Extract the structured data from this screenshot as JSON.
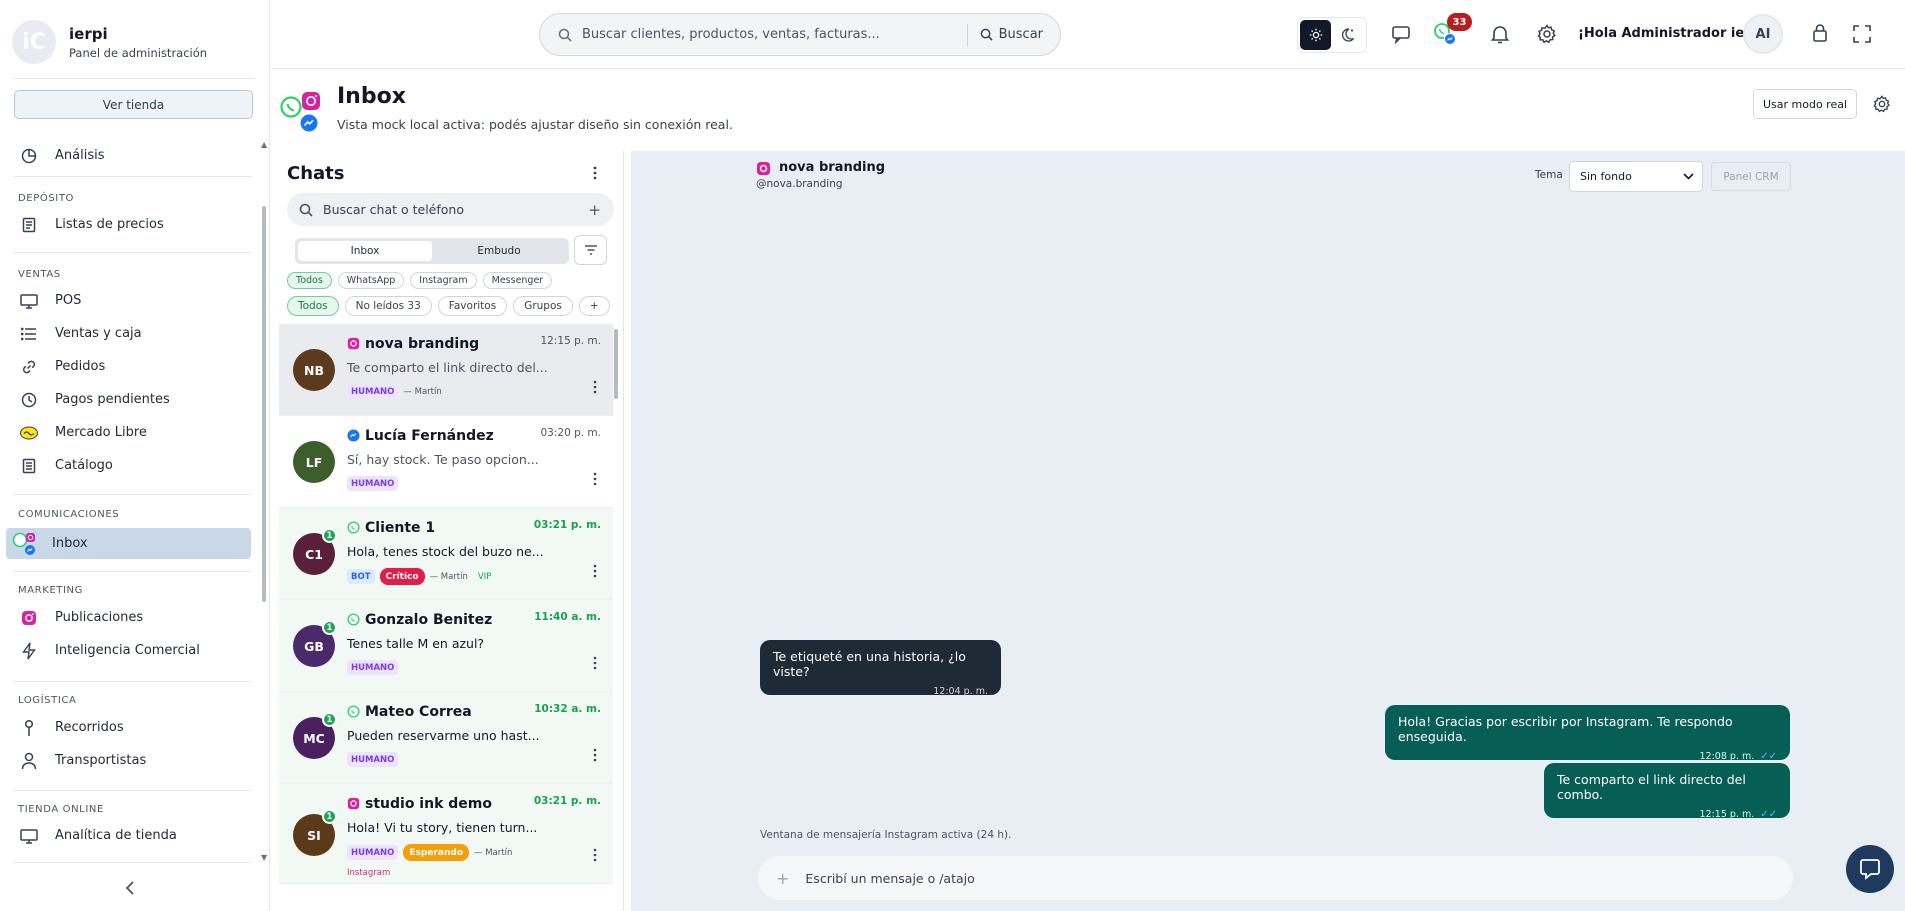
{
  "brand": {
    "logo": "iC",
    "name": "ierpi",
    "subtitle": "Panel de administración"
  },
  "sidebar": {
    "store_button": "Ver tienda",
    "top_item": {
      "label": "Análisis",
      "icon": "pie-chart-icon"
    },
    "sections": [
      {
        "title": "DEPÓSITO",
        "items": [
          {
            "label": "Listas de precios",
            "icon": "list-icon"
          }
        ]
      },
      {
        "title": "VENTAS",
        "items": [
          {
            "label": "POS",
            "icon": "monitor-icon"
          },
          {
            "label": "Ventas y caja",
            "icon": "list-lines-icon"
          },
          {
            "label": "Pedidos",
            "icon": "link-icon"
          },
          {
            "label": "Pagos pendientes",
            "icon": "clock-icon"
          },
          {
            "label": "Mercado Libre",
            "icon": "mercadolibre-icon"
          },
          {
            "label": "Catálogo",
            "icon": "document-icon"
          }
        ]
      },
      {
        "title": "COMUNICACIONES",
        "items": [
          {
            "label": "Inbox",
            "icon": "inbox-channels-icon",
            "active": true
          }
        ]
      },
      {
        "title": "MARKETING",
        "items": [
          {
            "label": "Publicaciones",
            "icon": "instagram-icon"
          },
          {
            "label": "Inteligencia Comercial",
            "icon": "bolt-icon"
          }
        ]
      },
      {
        "title": "LOGÍSTICA",
        "items": [
          {
            "label": "Recorridos",
            "icon": "pin-icon"
          },
          {
            "label": "Transportistas",
            "icon": "person-icon"
          }
        ]
      },
      {
        "title": "TIENDA ONLINE",
        "items": [
          {
            "label": "Analítica de tienda",
            "icon": "monitor-icon"
          }
        ]
      }
    ]
  },
  "header": {
    "search_placeholder": "Buscar clientes, productos, ventas, facturas...",
    "search_button": "Buscar",
    "notif_count": "33",
    "greeting": "¡Hola Administrador ierpi!",
    "avatar_initials": "AI"
  },
  "page": {
    "title": "Inbox",
    "subtitle": "Vista mock local activa: podés ajustar diseño sin conexión real.",
    "real_mode_button": "Usar modo real"
  },
  "chats": {
    "title": "Chats",
    "search_placeholder": "Buscar chat o teléfono",
    "tabs": [
      "Inbox",
      "Embudo"
    ],
    "channel_filters": [
      "Todos",
      "WhatsApp",
      "Instagram",
      "Messenger"
    ],
    "status_filters": [
      "Todos",
      "No leídos 33",
      "Favoritos",
      "Grupos",
      "+"
    ],
    "items": [
      {
        "initials": "NB",
        "color": "#5b3a1e",
        "channel": "instagram",
        "name": "nova branding",
        "time": "12:15 p. m.",
        "preview": "Te comparto el link directo del...",
        "tags": [
          "HUMANO"
        ],
        "owner": "— Martín",
        "selected": true
      },
      {
        "initials": "LF",
        "color": "#3b5e2b",
        "channel": "messenger",
        "name": "Lucía Fernández",
        "time": "03:20 p. m.",
        "preview": "Sí, hay stock. Te paso opcion...",
        "tags": [
          "HUMANO"
        ]
      },
      {
        "initials": "C1",
        "color": "#5a1f3b",
        "channel": "whatsapp",
        "name": "Cliente 1",
        "time": "03:21 p. m.",
        "preview": "Hola, tenes stock del buzo ne...",
        "unread": "1",
        "tags": [
          "BOT",
          "Crítico"
        ],
        "owner": "— Martín",
        "extra": "VIP"
      },
      {
        "initials": "GB",
        "color": "#4a2a6a",
        "channel": "whatsapp",
        "name": "Gonzalo Benitez",
        "time": "11:40 a. m.",
        "preview": "Tenes talle M en azul?",
        "unread": "1",
        "tags": [
          "HUMANO"
        ]
      },
      {
        "initials": "MC",
        "color": "#4a2060",
        "channel": "whatsapp",
        "name": "Mateo Correa",
        "time": "10:32 a. m.",
        "preview": "Pueden reservarme uno hast...",
        "unread": "1",
        "tags": [
          "HUMANO"
        ]
      },
      {
        "initials": "SI",
        "color": "#5a3a18",
        "channel": "instagram",
        "name": "studio ink demo",
        "time": "03:21 p. m.",
        "preview": "Hola! Vi tu story, tienen turn...",
        "unread": "1",
        "tags": [
          "HUMANO",
          "Esperando"
        ],
        "owner": "— Martín",
        "extra": "Instagram"
      }
    ]
  },
  "conversation": {
    "name": "nova branding",
    "handle": "@nova.branding",
    "theme_label": "Tema",
    "theme_value": "Sin fondo",
    "crm_button": "Panel CRM",
    "messages": [
      {
        "dir": "in",
        "text": "Te etiqueté en una historia, ¿lo viste?",
        "time": "12:04 p. m."
      },
      {
        "dir": "out",
        "text": "Hola! Gracias por escribir por Instagram. Te respondo enseguida.",
        "time": "12:08 p. m.",
        "ticks": "✓✓"
      },
      {
        "dir": "out",
        "text": "Te comparto el link directo del combo.",
        "time": "12:15 p. m.",
        "ticks": "✓✓"
      }
    ],
    "window_note": "Ventana de mensajería Instagram activa (24 h).",
    "composer_placeholder": "Escribí un mensaje o /atajo"
  }
}
